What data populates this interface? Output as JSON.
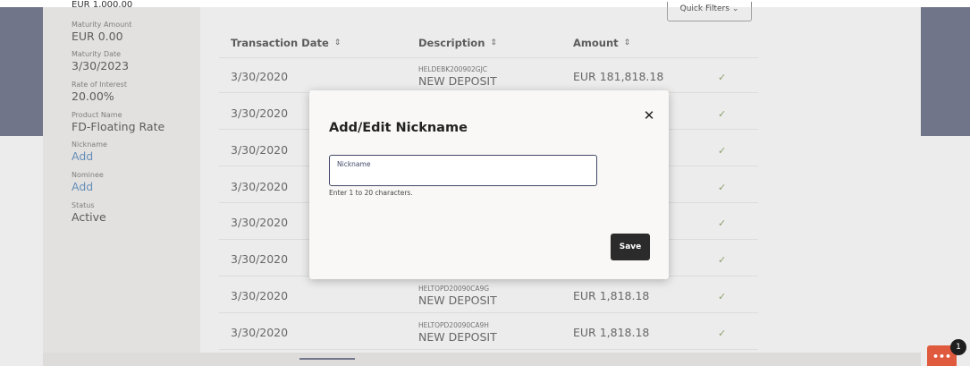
{
  "details": {
    "cut_top_value": "EUR 1,000.00",
    "maturity_amount": {
      "label": "Maturity Amount",
      "value": "EUR 0.00"
    },
    "maturity_date": {
      "label": "Maturity Date",
      "value": "3/30/2023"
    },
    "rate_of_interest": {
      "label": "Rate of Interest",
      "value": "20.00%"
    },
    "product_name": {
      "label": "Product Name",
      "value": "FD-Floating Rate"
    },
    "nickname": {
      "label": "Nickname",
      "link": "Add"
    },
    "nominee": {
      "label": "Nominee",
      "link": "Add"
    },
    "status": {
      "label": "Status",
      "value": "Active"
    }
  },
  "quick_filters_label": "Quick Filters",
  "table": {
    "columns": [
      "Transaction Date",
      "Description",
      "Amount"
    ],
    "rows": [
      {
        "date": "3/30/2020",
        "ref": "HELDEBK200902GJC",
        "desc": "NEW DEPOSIT",
        "amount": "EUR 181,818.18"
      },
      {
        "date": "3/30/2020",
        "ref": "",
        "desc": "",
        "amount": ""
      },
      {
        "date": "3/30/2020",
        "ref": "",
        "desc": "",
        "amount": ""
      },
      {
        "date": "3/30/2020",
        "ref": "",
        "desc": "",
        "amount": ""
      },
      {
        "date": "3/30/2020",
        "ref": "",
        "desc": "",
        "amount": ""
      },
      {
        "date": "3/30/2020",
        "ref": "",
        "desc": "",
        "amount": ""
      },
      {
        "date": "3/30/2020",
        "ref": "HELTOPD20090CA9G",
        "desc": "NEW DEPOSIT",
        "amount": "EUR 1,818.18"
      },
      {
        "date": "3/30/2020",
        "ref": "HELTOPD20090CA9H",
        "desc": "NEW DEPOSIT",
        "amount": "EUR 1,818.18"
      }
    ]
  },
  "modal": {
    "title": "Add/Edit Nickname",
    "close_glyph": "✕",
    "field_label": "Nickname",
    "field_value": "",
    "hint": "Enter 1 to 20 characters.",
    "save_label": "Save"
  },
  "icons": {
    "sort": "⇕",
    "check": "✓",
    "chevron_down": "⌄",
    "chat": "•••"
  },
  "chat_badge_count": "1",
  "colors": {
    "brand": "#434968",
    "link": "#2f6fb3",
    "check": "#6e8a3a",
    "chat": "#e05a3d",
    "save_button": "#2b2b2b"
  }
}
